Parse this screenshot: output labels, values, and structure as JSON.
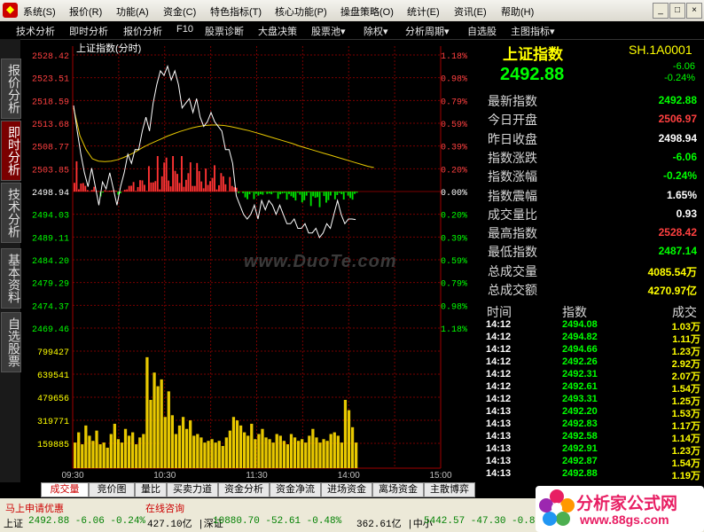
{
  "menu": {
    "items": [
      "系统(S)",
      "报价(R)",
      "功能(A)",
      "资金(C)",
      "特色指标(T)",
      "核心功能(P)",
      "操盘策略(O)",
      "统计(E)",
      "资讯(E)",
      "帮助(H)"
    ]
  },
  "window_buttons": [
    "_",
    "□",
    "×"
  ],
  "toolbar": {
    "items": [
      "技术分析",
      "即时分析",
      "报价分析",
      "F10",
      "股票诊断",
      "大盘决策",
      "股票池▾",
      "除权▾",
      "分析周期▾",
      "自选股",
      "主图指标▾"
    ]
  },
  "left_tabs": [
    "报价分析",
    "即时分析",
    "技术分析",
    "基本资料",
    "自选股票"
  ],
  "chart_header": {
    "title": "上证指数(分时)"
  },
  "watermark": "www.DuoTe.com",
  "chart_data": {
    "type": "line",
    "title": "上证指数(分时)",
    "price_ticks": [
      "2528.42",
      "2523.51",
      "2518.59",
      "2513.68",
      "2508.77",
      "2503.85",
      "2498.94",
      "2494.03",
      "2489.11",
      "2484.20",
      "2479.29",
      "2474.37",
      "2469.46"
    ],
    "pct_ticks": [
      "1.18%",
      "0.98%",
      "0.79%",
      "0.59%",
      "0.39%",
      "0.20%",
      "0.00%",
      "0.20%",
      "0.39%",
      "0.59%",
      "0.79%",
      "0.98%",
      "1.18%"
    ],
    "volume_ticks": [
      "799427",
      "639541",
      "479656",
      "319771",
      "159885"
    ],
    "time_ticks": [
      "09:30",
      "10:30",
      "11:30",
      "14:00",
      "15:00"
    ],
    "ylim": [
      2469.46,
      2528.42
    ],
    "prev_close": 2498.94,
    "price_series": [
      2517.5,
      2512,
      2507,
      2503,
      2500,
      2504,
      2500,
      2496,
      2501,
      2499.5,
      2503,
      2499.5,
      2496,
      2500,
      2503,
      2507,
      2505,
      2508,
      2508,
      2512,
      2515,
      2512,
      2518,
      2522,
      2525,
      2524,
      2526,
      2523,
      2525,
      2522,
      2517,
      2518,
      2519,
      2516,
      2519,
      2515,
      2513,
      2514,
      2516,
      2514,
      2513,
      2512,
      2508,
      2508,
      2505,
      2498,
      2496,
      2494,
      2493,
      2494,
      2496,
      2493,
      2497,
      2495,
      2497,
      2496,
      2494,
      2496,
      2494,
      2492,
      2492,
      2493,
      2491,
      2491,
      2492,
      2490,
      2490,
      2491,
      2489,
      2490,
      2492,
      2491,
      2494,
      2497,
      2494,
      2492,
      2493,
      2493,
      2492.9
    ],
    "avg_series": [
      2517,
      2511,
      2508,
      2506,
      2505.5,
      2505.4,
      2505.5,
      2505.8,
      2506.3,
      2506.9,
      2507.6,
      2508.4,
      2509.1,
      2509.7,
      2510.3,
      2510.9,
      2511.4,
      2511.9,
      2512.3,
      2512.7,
      2513,
      2513.2,
      2513.3,
      2513.3,
      2513.2,
      2513,
      2512.7,
      2512.4,
      2512.1,
      2511.7,
      2511.3,
      2510.9,
      2510.5,
      2510.1,
      2509.7,
      2509.3,
      2508.8,
      2508.4,
      2508,
      2507.6,
      2507.2,
      2506.8,
      2506.4,
      2506,
      2505.6,
      2505.2,
      2504.8,
      2504.4,
      2504.1
    ],
    "volume_series": [
      150,
      210,
      140,
      250,
      190,
      160,
      220,
      140,
      150,
      120,
      200,
      260,
      170,
      150,
      230,
      190,
      210,
      140,
      180,
      200,
      650,
      400,
      560,
      480,
      520,
      300,
      450,
      310,
      200,
      250,
      300,
      230,
      280,
      190,
      200,
      180,
      150,
      160,
      170,
      150,
      160,
      130,
      180,
      220,
      300,
      280,
      250,
      210,
      190,
      260,
      170,
      200,
      230,
      180,
      170,
      150,
      200,
      190,
      160,
      140,
      200,
      180,
      160,
      170,
      150,
      190,
      230,
      180,
      150,
      170,
      160,
      200,
      210,
      190,
      150,
      400,
      340,
      240,
      150
    ]
  },
  "quote": {
    "name": "上证指数",
    "code": "SH.1A0001",
    "price": "2492.88",
    "change": "-6.06",
    "change_pct": "-0.24%",
    "rows": [
      {
        "label": "最新指数",
        "value": "2492.88",
        "color": "#00ff00"
      },
      {
        "label": "今日开盘",
        "value": "2506.97",
        "color": "#ff4040"
      },
      {
        "label": "昨日收盘",
        "value": "2498.94",
        "color": "#ffffff"
      },
      {
        "label": "指数涨跌",
        "value": "-6.06",
        "color": "#00ff00"
      },
      {
        "label": "指数涨幅",
        "value": "-0.24%",
        "color": "#00ff00"
      },
      {
        "label": "指数震幅",
        "value": "1.65%",
        "color": "#ffffff"
      },
      {
        "label": "成交量比",
        "value": "0.93",
        "color": "#ffffff"
      },
      {
        "label": "最高指数",
        "value": "2528.42",
        "color": "#ff4040"
      },
      {
        "label": "最低指数",
        "value": "2487.14",
        "color": "#00ff00"
      },
      {
        "label": "总成交量",
        "value": "4085.54万",
        "color": "#ffff00"
      },
      {
        "label": "总成交额",
        "value": "4270.97亿",
        "color": "#ffff00"
      }
    ]
  },
  "ticks": {
    "headers": [
      "时间",
      "指数",
      "成交"
    ],
    "rows": [
      {
        "time": "14:12",
        "index": "2494.08",
        "vol": "1.03万"
      },
      {
        "time": "14:12",
        "index": "2494.82",
        "vol": "1.11万"
      },
      {
        "time": "14:12",
        "index": "2494.66",
        "vol": "1.23万"
      },
      {
        "time": "14:12",
        "index": "2492.26",
        "vol": "2.92万"
      },
      {
        "time": "14:12",
        "index": "2492.31",
        "vol": "2.07万"
      },
      {
        "time": "14:12",
        "index": "2492.61",
        "vol": "1.54万"
      },
      {
        "time": "14:12",
        "index": "2493.31",
        "vol": "1.25万"
      },
      {
        "time": "14:13",
        "index": "2492.20",
        "vol": "1.53万"
      },
      {
        "time": "14:13",
        "index": "2492.83",
        "vol": "1.17万"
      },
      {
        "time": "14:13",
        "index": "2492.58",
        "vol": "1.14万"
      },
      {
        "time": "14:13",
        "index": "2492.91",
        "vol": "1.23万"
      },
      {
        "time": "14:13",
        "index": "2492.87",
        "vol": "1.54万"
      },
      {
        "time": "14:13",
        "index": "2492.88",
        "vol": "1.19万"
      }
    ]
  },
  "bottom_tabs": [
    "成交量",
    "竞价图",
    "量比",
    "买卖力道",
    "资金分析",
    "资金净流",
    "进场资金",
    "离场资金",
    "主散博弈"
  ],
  "status": {
    "left1": "马上申请优惠",
    "left2": "在线咨询",
    "ticker": [
      {
        "text": "上证",
        "color": "#000000"
      },
      {
        "text": "2492.88 -6.06 -0.24%",
        "color": "#008000"
      },
      {
        "text": "427.10亿 |深证",
        "color": "#000000"
      },
      {
        "text": "10880.70 -52.61 -0.48%",
        "color": "#008000"
      },
      {
        "text": "362.61亿 |中小",
        "color": "#000000"
      },
      {
        "text": "5442.57 -47.30 -0.86%",
        "color": "#008000"
      }
    ]
  },
  "brand": {
    "line1": "分析家公式网",
    "line2": "www.88gs.com"
  },
  "colors": {
    "up": "#ff4040",
    "down": "#00ff00",
    "grid": "#7a0000",
    "bg": "#000000"
  }
}
